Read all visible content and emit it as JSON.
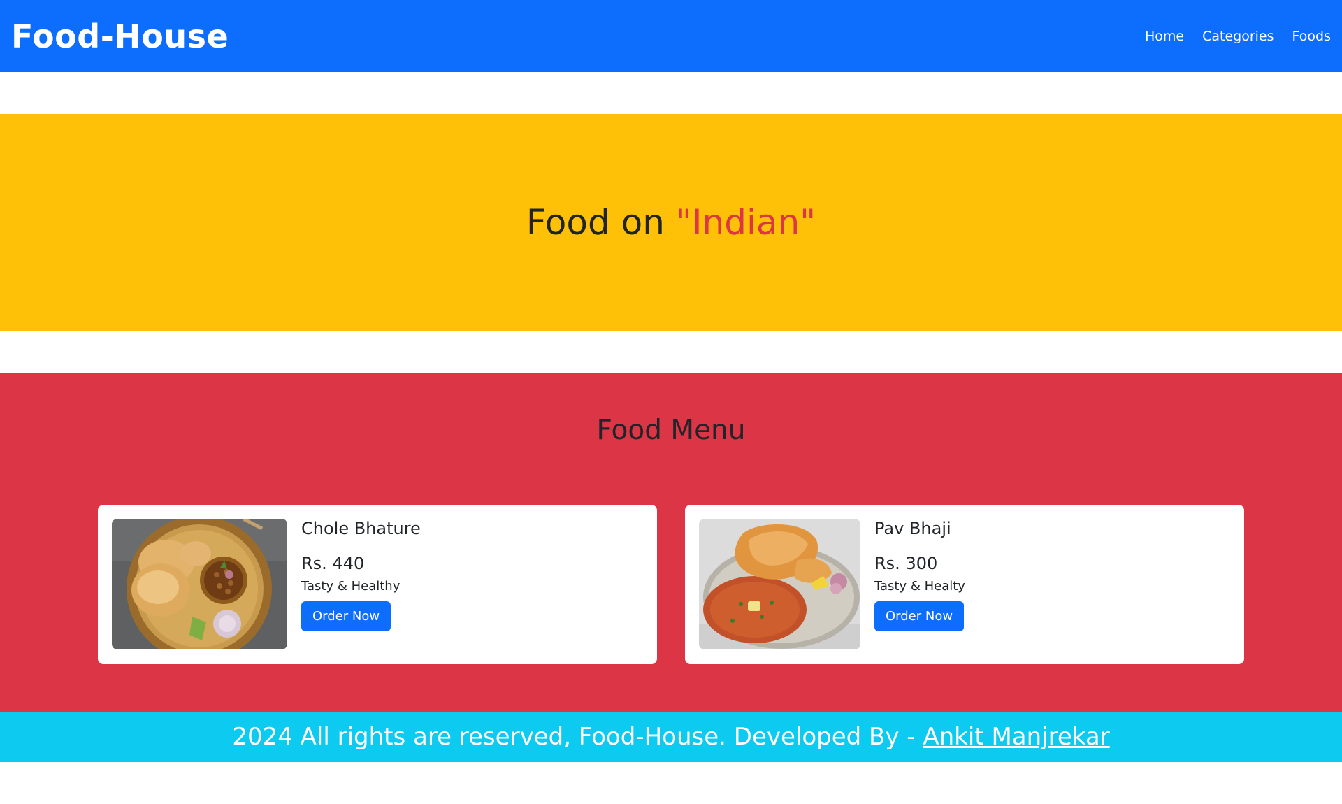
{
  "navbar": {
    "brand": "Food-House",
    "links": [
      {
        "label": "Home"
      },
      {
        "label": "Categories"
      },
      {
        "label": "Foods"
      }
    ],
    "bg_color": "#0d6efd"
  },
  "hero": {
    "prefix": "Food on ",
    "category": "\"Indian\"",
    "bg_color": "#ffc107",
    "highlight_color": "#dc3545"
  },
  "menu": {
    "title": "Food Menu",
    "bg_color": "#dc3545",
    "items": [
      {
        "name": "Chole Bhature",
        "price": "Rs. 440",
        "description": "Tasty & Healthy",
        "button": "Order Now",
        "image": "chole-bhature-photo"
      },
      {
        "name": "Pav Bhaji",
        "price": "Rs. 300",
        "description": "Tasty & Healty",
        "button": "Order Now",
        "image": "pav-bhaji-photo"
      }
    ]
  },
  "footer": {
    "text": "2024 All rights are reserved, Food-House. Developed By - ",
    "author": "Ankit Manjrekar",
    "bg_color": "#0dcaf0"
  }
}
